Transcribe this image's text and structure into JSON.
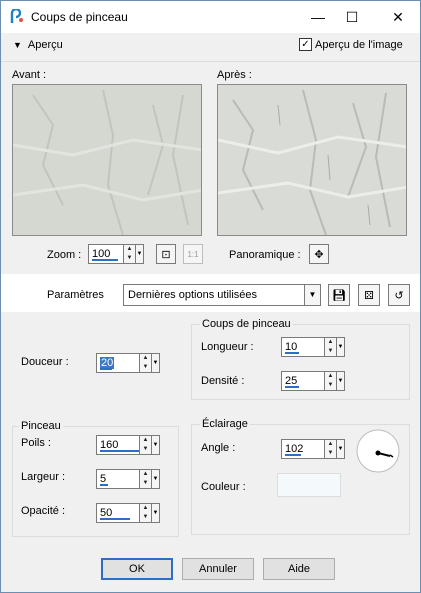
{
  "window": {
    "title": "Coups de pinceau"
  },
  "titlebar": {
    "minimize": "—",
    "maximize": "☐",
    "close": "✕"
  },
  "header": {
    "apercu_toggle": "Aperçu",
    "apercu_image_label": "Aperçu de l'image",
    "apercu_image_checked": true
  },
  "preview": {
    "before_label": "Avant :",
    "after_label": "Après :",
    "zoom_label": "Zoom :",
    "zoom_value": "100",
    "pan_label": "Panoramique :"
  },
  "params": {
    "label": "Paramètres",
    "preset_value": "Dernières options utilisées"
  },
  "douceur": {
    "label": "Douceur :",
    "value": "20"
  },
  "coups": {
    "title": "Coups de pinceau",
    "longueur_label": "Longueur :",
    "longueur_value": "10",
    "densite_label": "Densité :",
    "densite_value": "25"
  },
  "pinceau": {
    "title": "Pinceau",
    "poils_label": "Poils :",
    "poils_value": "160",
    "largeur_label": "Largeur :",
    "largeur_value": "5",
    "opacite_label": "Opacité :",
    "opacite_value": "50"
  },
  "eclairage": {
    "title": "Éclairage",
    "angle_label": "Angle :",
    "angle_value": "102",
    "couleur_label": "Couleur :",
    "couleur_color": "#f4fafc"
  },
  "buttons": {
    "ok": "OK",
    "annuler": "Annuler",
    "aide": "Aide"
  }
}
